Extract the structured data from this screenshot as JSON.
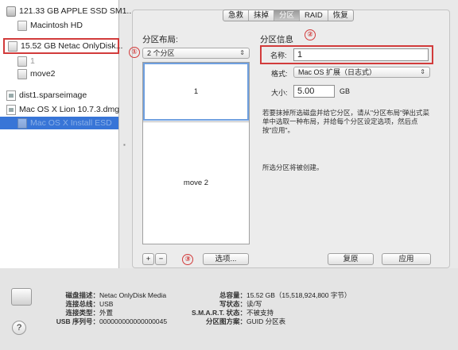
{
  "sidebar": {
    "items": [
      {
        "label": "121.33 GB APPLE SSD SM1...",
        "icon": "internal-disk-icon"
      },
      {
        "label": "Macintosh HD",
        "icon": "volume-icon"
      },
      {
        "label": "15.52 GB Netac OnlyDisk...",
        "icon": "usb-disk-icon"
      },
      {
        "label": "1",
        "icon": "volume-icon"
      },
      {
        "label": "move2",
        "icon": "volume-icon"
      },
      {
        "label": "dist1.sparseimage",
        "icon": "disk-image-icon"
      },
      {
        "label": "Mac OS X Lion 10.7.3.dmg",
        "icon": "disk-image-icon"
      },
      {
        "label": "Mac OS X Install ESD",
        "icon": "volume-icon"
      }
    ]
  },
  "tabs": [
    "急救",
    "抹掉",
    "分区",
    "RAID",
    "恢复"
  ],
  "active_tab": "分区",
  "partition_layout": {
    "heading": "分区布局:",
    "scheme_value": "2 个分区",
    "partitions": [
      {
        "name": "1"
      },
      {
        "name": "move 2"
      }
    ],
    "add_label": "+",
    "remove_label": "−",
    "options_label": "选项..."
  },
  "partition_info": {
    "heading": "分区信息",
    "name_label": "名称:",
    "name_value": "1",
    "format_label": "格式:",
    "format_value": "Mac OS 扩展（日志式）",
    "size_label": "大小:",
    "size_value": "5.00",
    "size_unit": "GB",
    "description": "若要抹掉所选磁盘并给它分区，请从\"分区布局\"弹出式菜单中选取一种布局，并给每个分区设定选项，然后点按\"应用\"。",
    "status": "所选分区将被创建。",
    "revert_label": "复原",
    "apply_label": "应用"
  },
  "annotations": [
    "①",
    "②",
    "③"
  ],
  "footer": {
    "left": [
      {
        "key": "磁盘描述：",
        "value": "Netac OnlyDisk Media"
      },
      {
        "key": "连接总线：",
        "value": "USB"
      },
      {
        "key": "连接类型：",
        "value": "外置"
      },
      {
        "key": "USB 序列号：",
        "value": "000000000000000045"
      }
    ],
    "right": [
      {
        "key": "总容量：",
        "value": "15.52 GB（15,518,924,800 字节）"
      },
      {
        "key": "写状态：",
        "value": "读/写"
      },
      {
        "key": "S.M.A.R.T. 状态：",
        "value": "不被支持"
      },
      {
        "key": "分区图方案：",
        "value": "GUID 分区表"
      }
    ],
    "help_label": "?"
  },
  "colors": {
    "annotation_red": "#d23b3b",
    "selection_blue": "#3875d7"
  }
}
